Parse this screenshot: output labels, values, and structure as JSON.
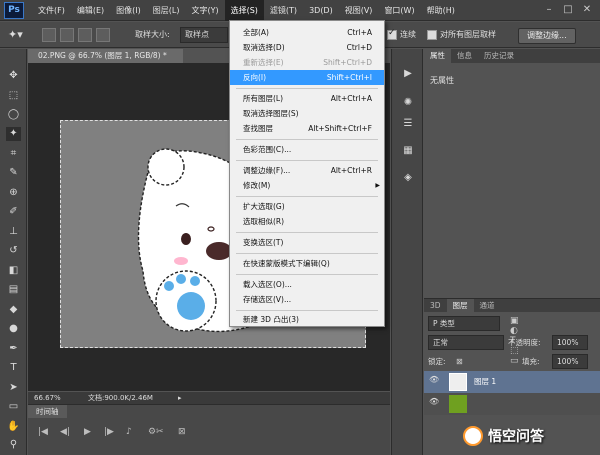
{
  "menubar": {
    "logo": "Ps",
    "items": [
      "文件(F)",
      "编辑(E)",
      "图像(I)",
      "图层(L)",
      "文字(Y)",
      "选择(S)",
      "滤镜(T)",
      "3D(D)",
      "视图(V)",
      "窗口(W)",
      "帮助(H)"
    ],
    "active_index": 5
  },
  "options": {
    "sample_size_label": "取样大小:",
    "sample_size_value": "取样点",
    "continuous_label": "连续",
    "all_layers_label": "对所有图层取样",
    "refine_edge": "调整边缘..."
  },
  "document": {
    "tab": "02.PNG @ 66.7% (图层 1, RGB/8) *",
    "zoom": "66.67%",
    "doc_info": "文档:900.0K/2.46M"
  },
  "timeline": {
    "tab": "时间轴"
  },
  "properties": {
    "tabs": [
      "属性",
      "信息",
      "历史记录"
    ],
    "body": "无属性"
  },
  "layers": {
    "tabs": [
      "3D",
      "图层",
      "通道"
    ],
    "kind_filter": "P 类型",
    "blend_mode": "正常",
    "opacity_label": "不透明度:",
    "opacity_value": "100%",
    "lock_label": "锁定:",
    "fill_label": "填充:",
    "fill_value": "100%",
    "layer_name": "图层 1"
  },
  "select_menu": {
    "items": [
      {
        "label": "全部(A)",
        "shortcut": "Ctrl+A"
      },
      {
        "label": "取消选择(D)",
        "shortcut": "Ctrl+D"
      },
      {
        "label": "重新选择(E)",
        "shortcut": "Shift+Ctrl+D"
      },
      {
        "label": "反向(I)",
        "shortcut": "Shift+Ctrl+I"
      },
      {
        "label": "所有图层(L)",
        "shortcut": "Alt+Ctrl+A"
      },
      {
        "label": "取消选择图层(S)",
        "shortcut": ""
      },
      {
        "label": "查找图层",
        "shortcut": "Alt+Shift+Ctrl+F"
      },
      {
        "label": "色彩范围(C)...",
        "shortcut": ""
      },
      {
        "label": "调整边缘(F)...",
        "shortcut": "Alt+Ctrl+R"
      },
      {
        "label": "修改(M)",
        "shortcut": ""
      },
      {
        "label": "扩大选取(G)",
        "shortcut": ""
      },
      {
        "label": "选取相似(R)",
        "shortcut": ""
      },
      {
        "label": "变换选区(T)",
        "shortcut": ""
      },
      {
        "label": "在快速蒙版模式下编辑(Q)",
        "shortcut": ""
      },
      {
        "label": "载入选区(O)...",
        "shortcut": ""
      },
      {
        "label": "存储选区(V)...",
        "shortcut": ""
      },
      {
        "label": "新建 3D 凸出(3)",
        "shortcut": ""
      }
    ]
  },
  "watermark": {
    "text": "悟空问答"
  },
  "colors": {
    "menu_highlight": "#3399ff",
    "layer_selected": "#5f7391"
  }
}
